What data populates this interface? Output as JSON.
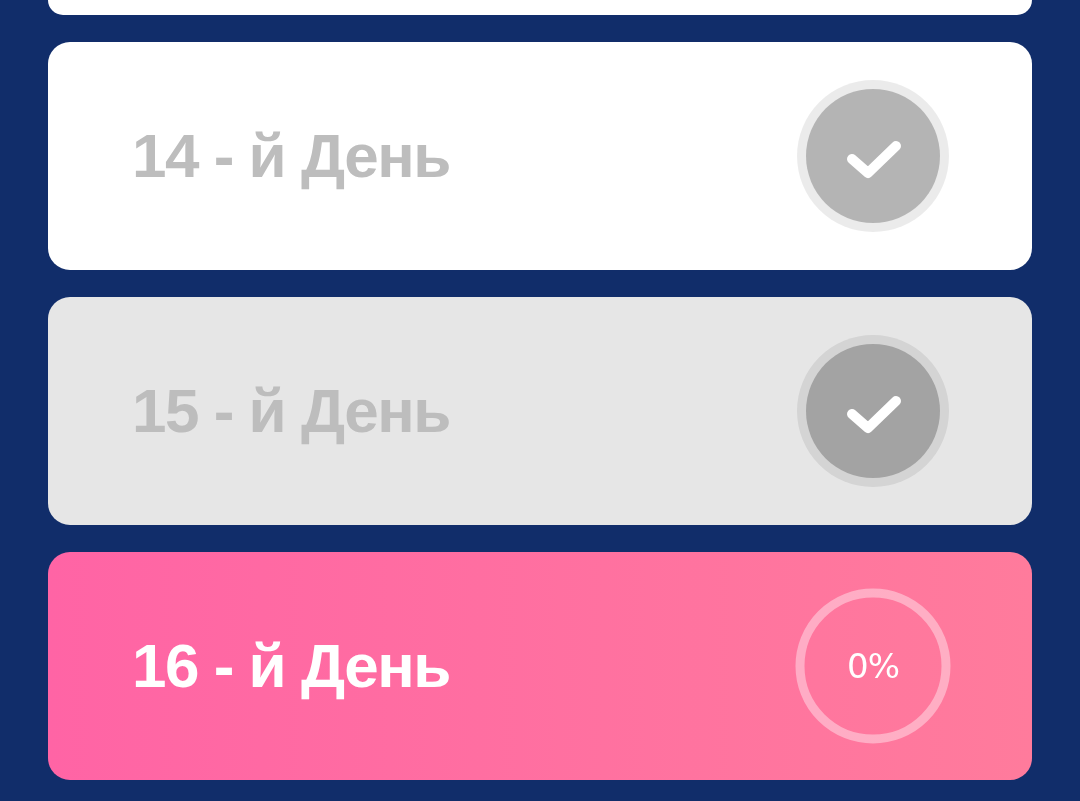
{
  "card_above_cut_off": true,
  "days": [
    {
      "label": "14 - й День",
      "kind": "done",
      "selected": false
    },
    {
      "label": "15 - й День",
      "kind": "done",
      "selected": true
    },
    {
      "label": "16 - й День",
      "kind": "current",
      "selected": false,
      "reading": "0%"
    }
  ]
}
